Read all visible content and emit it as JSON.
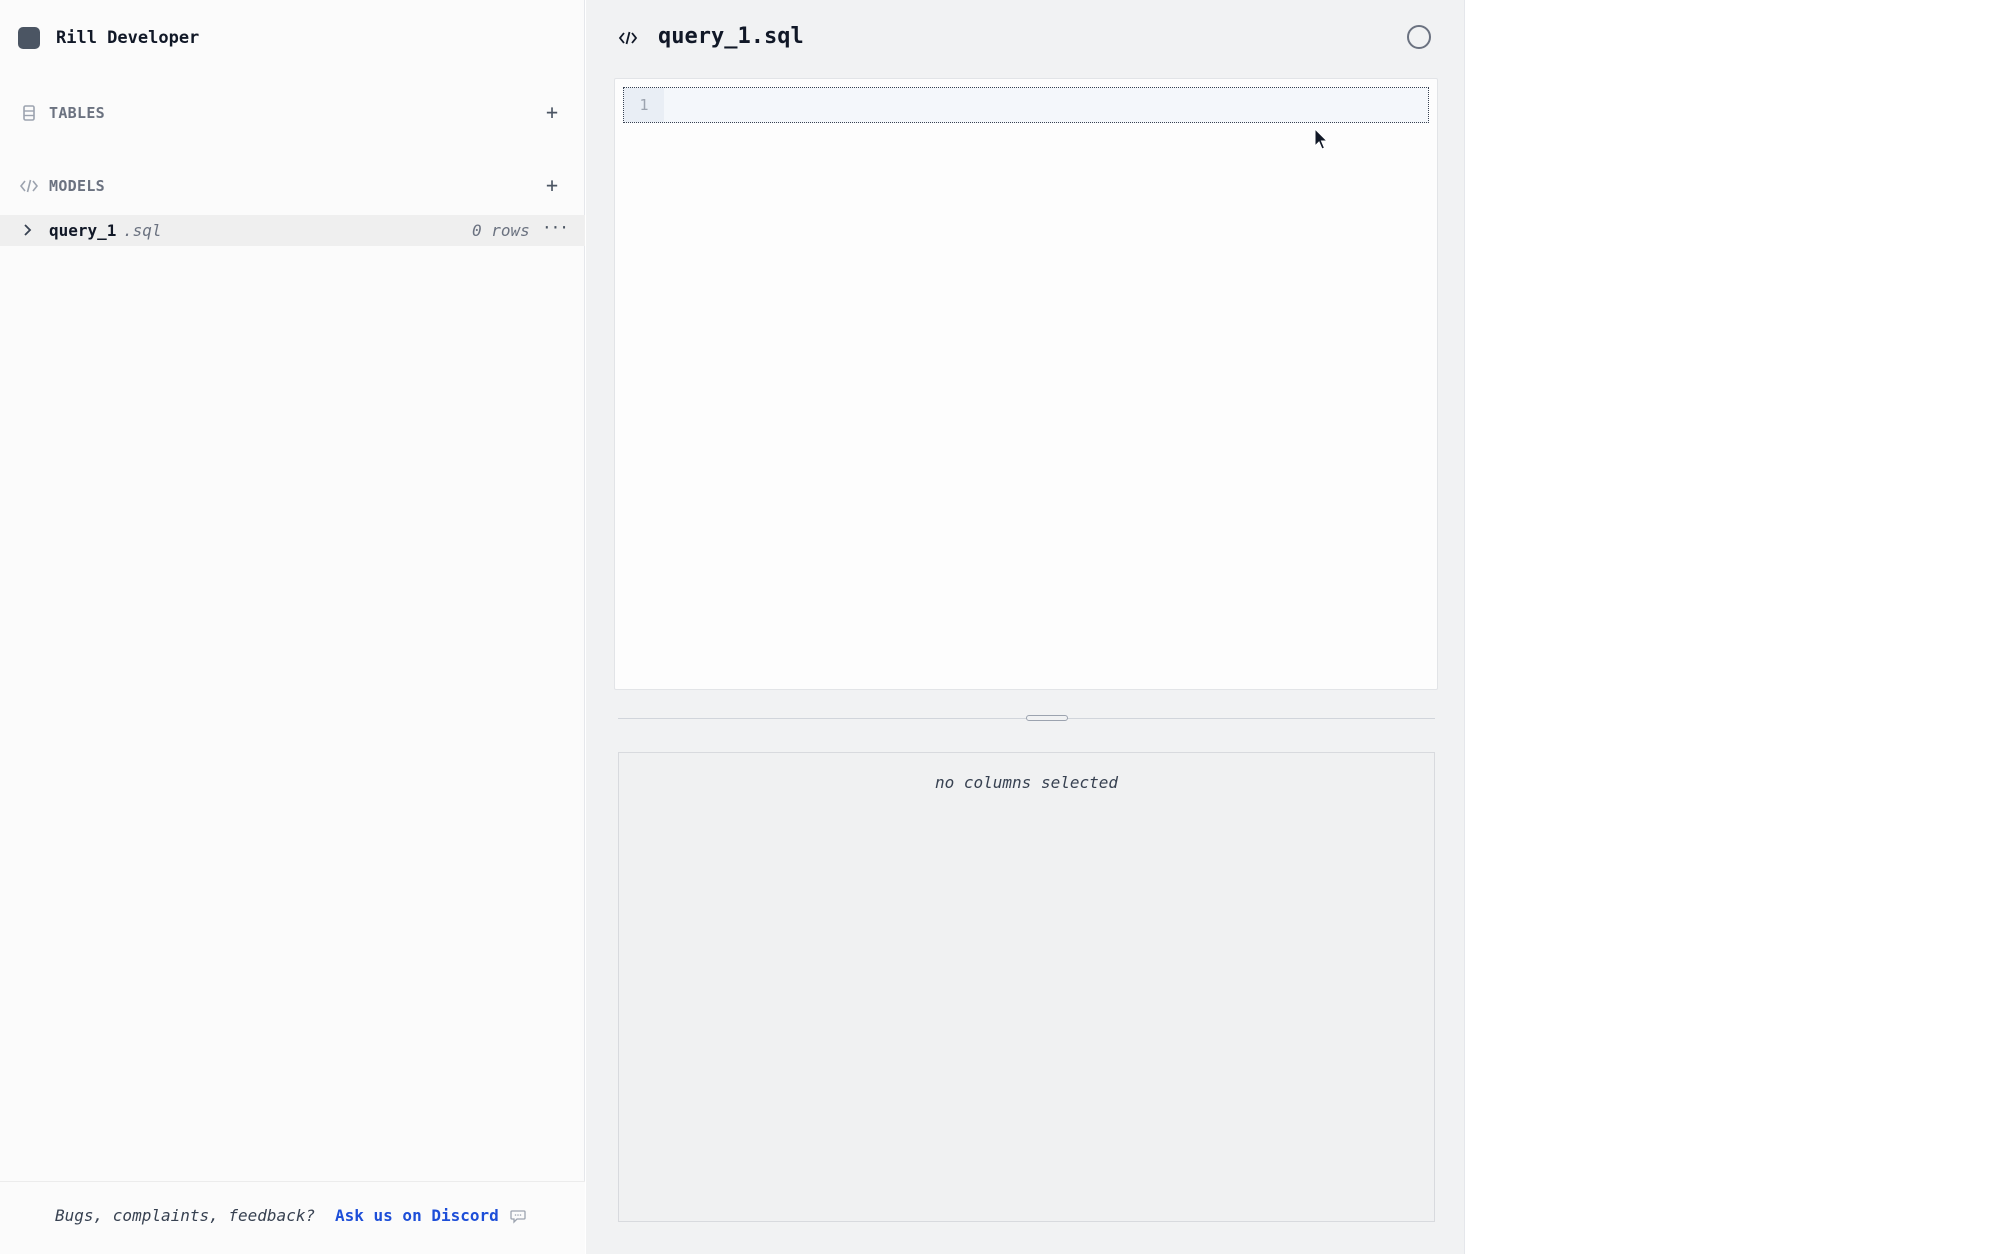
{
  "app": {
    "title": "Rill Developer"
  },
  "sidebar": {
    "tables": {
      "label": "TABLES",
      "add_symbol": "+"
    },
    "models": {
      "label": "MODELS",
      "add_symbol": "+",
      "items": [
        {
          "name": "query_1",
          "ext": ".sql",
          "rows": "0 rows",
          "more": "···"
        }
      ]
    }
  },
  "footer": {
    "text": "Bugs, complaints, feedback?",
    "link": "Ask us on Discord"
  },
  "editor": {
    "title": "query_1.sql",
    "line_number": "1"
  },
  "results": {
    "empty_message": "no columns selected"
  },
  "colors": {
    "link": "#1d4ed8",
    "sidebar_bg": "#fbfbfb",
    "main_bg": "#f1f2f3"
  }
}
